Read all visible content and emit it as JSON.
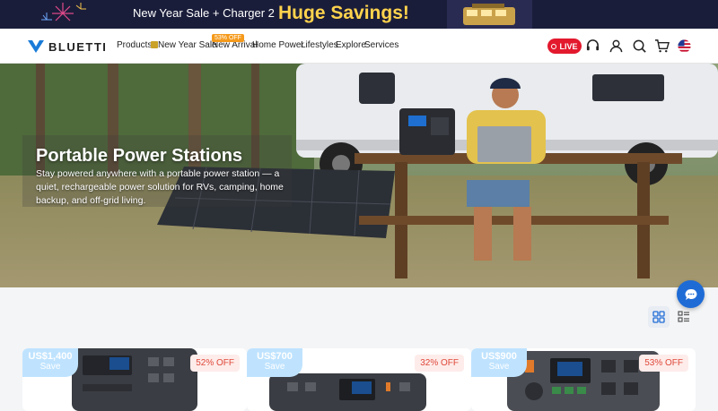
{
  "promo": {
    "text": "New Year Sale + Charger 2",
    "highlight": "Huge Savings!"
  },
  "brand": {
    "name": "BLUETTI"
  },
  "nav": {
    "items": [
      "Products",
      "New Year Sale",
      "New Arrival",
      "Home Power",
      "Lifestyles",
      "Explore",
      "Services"
    ],
    "new_arrival_badge": "53% OFF",
    "live_label": "LIVE"
  },
  "hero": {
    "title": "Portable Power Stations",
    "description": "Stay powered anywhere with a portable power station — a quiet, rechargeable power solution for RVs, camping, home backup, and off-grid living."
  },
  "products": [
    {
      "price": "US$1,400",
      "save": "Save",
      "discount": "52% OFF"
    },
    {
      "price": "US$700",
      "save": "Save",
      "discount": "32% OFF"
    },
    {
      "price": "US$900",
      "save": "Save",
      "discount": "53% OFF"
    }
  ],
  "colors": {
    "live": "#e3192e",
    "accent": "#1e6bd6",
    "promo_bg": "#1a1d3a",
    "highlight": "#ffd34d"
  }
}
